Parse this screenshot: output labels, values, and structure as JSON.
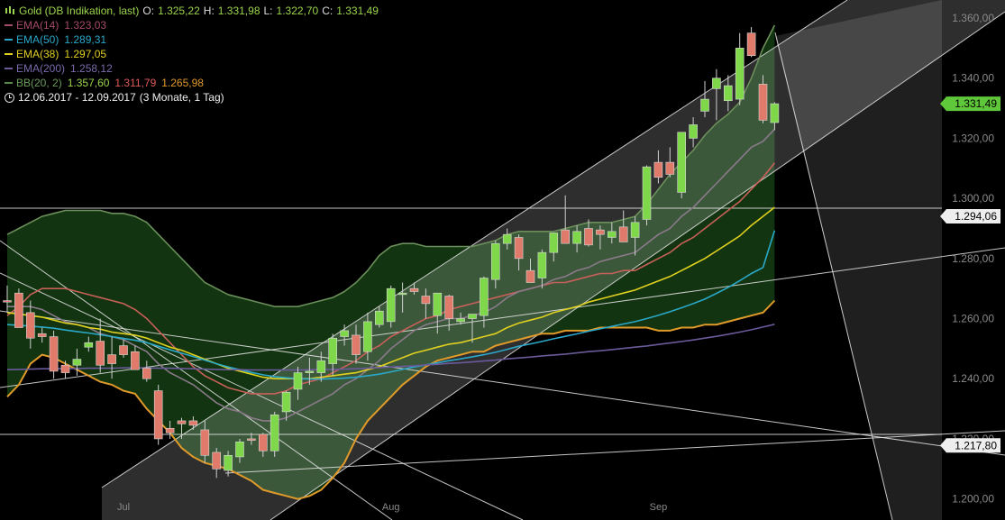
{
  "legend": {
    "symbol_label": "Gold (DB Indikation, last)",
    "ohlc": {
      "o_label": "O:",
      "o": "1.325,22",
      "h_label": "H:",
      "h": "1.331,98",
      "l_label": "L:",
      "l": "1.322,70",
      "c_label": "C:",
      "c": "1.331,49"
    },
    "indicators": [
      {
        "label": "EMA(14)",
        "value": "1.323,03",
        "color": "#a44a6a"
      },
      {
        "label": "EMA(50)",
        "value": "1.289,31",
        "color": "#2aa8c8"
      },
      {
        "label": "EMA(38)",
        "value": "1.297,05",
        "color": "#e0d020"
      },
      {
        "label": "EMA(200)",
        "value": "1.258,12",
        "color": "#6a5a9a"
      }
    ],
    "bb": {
      "label": "BB(20, 2)",
      "upper": "1.357,60",
      "mid": "1.311,79",
      "lower": "1.265,98",
      "color": "#5a8a4a",
      "upper_color": "#9bd44a",
      "mid_color": "#e05a5a",
      "lower_color": "#e09a2a"
    },
    "range": "12.06.2017 - 12.09.2017",
    "range_detail": "(3 Monate, 1 Tag)"
  },
  "chart_data": {
    "type": "candlestick",
    "title": "Gold (DB Indikation, last)",
    "period": "12.06.2017 - 12.09.2017",
    "ylim": [
      1193,
      1366
    ],
    "yticks": [
      1200,
      1220,
      1240,
      1260,
      1280,
      1300,
      1320,
      1340,
      1360
    ],
    "ytick_labels": [
      "1.200,00",
      "1.220,00",
      "1.240,00",
      "1.260,00",
      "1.280,00",
      "1.300,00",
      "1.320,00",
      "1.340,00",
      "1.360,00"
    ],
    "x_tick_labels": [
      {
        "label": "Jul",
        "at": 10
      },
      {
        "label": "Aug",
        "at": 33
      },
      {
        "label": "Sep",
        "at": 56
      }
    ],
    "price_tags": [
      {
        "label": "1.331,49",
        "value": 1331.49,
        "color": "#5fc83a",
        "text_color": "#000"
      },
      {
        "label": "1.294,06",
        "value": 1294.06,
        "color": "#eeeeee",
        "text_color": "#000"
      },
      {
        "label": "1.217,80",
        "value": 1217.8,
        "color": "#eeeeee",
        "text_color": "#000"
      }
    ],
    "horizontal_lines": [
      1294.06,
      1217.8
    ],
    "candles": [
      {
        "o": 1266.0,
        "h": 1271.0,
        "l": 1262.0,
        "c": 1265.5
      },
      {
        "o": 1268.5,
        "h": 1270.0,
        "l": 1260.0,
        "c": 1257.0
      },
      {
        "o": 1262.0,
        "h": 1266.0,
        "l": 1250.0,
        "c": 1253.5
      },
      {
        "o": 1255.0,
        "h": 1257.0,
        "l": 1252.0,
        "c": 1254.0
      },
      {
        "o": 1254.0,
        "h": 1256.0,
        "l": 1240.0,
        "c": 1242.5
      },
      {
        "o": 1244.5,
        "h": 1246.0,
        "l": 1240.0,
        "c": 1242.0
      },
      {
        "o": 1244.5,
        "h": 1250.0,
        "l": 1241.0,
        "c": 1246.5
      },
      {
        "o": 1250.5,
        "h": 1254.0,
        "l": 1249.0,
        "c": 1252.0
      },
      {
        "o": 1252.5,
        "h": 1260.0,
        "l": 1242.0,
        "c": 1244.5
      },
      {
        "o": 1248.0,
        "h": 1254.0,
        "l": 1240.0,
        "c": 1245.0
      },
      {
        "o": 1251.0,
        "h": 1253.0,
        "l": 1247.0,
        "c": 1248.0
      },
      {
        "o": 1249.0,
        "h": 1251.0,
        "l": 1244.0,
        "c": 1243.0
      },
      {
        "o": 1243.5,
        "h": 1246.0,
        "l": 1239.0,
        "c": 1240.0
      },
      {
        "o": 1236.0,
        "h": 1238.0,
        "l": 1218.0,
        "c": 1220.0
      },
      {
        "o": 1223.5,
        "h": 1226.0,
        "l": 1220.0,
        "c": 1222.0
      },
      {
        "o": 1226.0,
        "h": 1227.0,
        "l": 1220.0,
        "c": 1225.0
      },
      {
        "o": 1226.0,
        "h": 1227.5,
        "l": 1223.0,
        "c": 1224.5
      },
      {
        "o": 1223.0,
        "h": 1226.0,
        "l": 1212.0,
        "c": 1214.5
      },
      {
        "o": 1215.5,
        "h": 1217.0,
        "l": 1207.0,
        "c": 1210.0
      },
      {
        "o": 1209.5,
        "h": 1216.0,
        "l": 1207.5,
        "c": 1214.5
      },
      {
        "o": 1214.0,
        "h": 1220.0,
        "l": 1212.0,
        "c": 1219.0
      },
      {
        "o": 1220.0,
        "h": 1222.0,
        "l": 1218.0,
        "c": 1219.5
      },
      {
        "o": 1221.5,
        "h": 1222.0,
        "l": 1214.0,
        "c": 1216.0
      },
      {
        "o": 1216.0,
        "h": 1229.0,
        "l": 1214.0,
        "c": 1228.0
      },
      {
        "o": 1229.0,
        "h": 1236.0,
        "l": 1226.0,
        "c": 1235.5
      },
      {
        "o": 1236.5,
        "h": 1244.0,
        "l": 1233.0,
        "c": 1242.0
      },
      {
        "o": 1242.0,
        "h": 1247.0,
        "l": 1238.0,
        "c": 1242.5
      },
      {
        "o": 1242.0,
        "h": 1249.0,
        "l": 1239.0,
        "c": 1246.0
      },
      {
        "o": 1245.0,
        "h": 1255.0,
        "l": 1241.0,
        "c": 1253.5
      },
      {
        "o": 1254.0,
        "h": 1258.0,
        "l": 1251.0,
        "c": 1256.0
      },
      {
        "o": 1254.5,
        "h": 1258.0,
        "l": 1245.0,
        "c": 1248.0
      },
      {
        "o": 1249.0,
        "h": 1262.0,
        "l": 1246.0,
        "c": 1259.0
      },
      {
        "o": 1258.0,
        "h": 1264.0,
        "l": 1257.0,
        "c": 1262.5
      },
      {
        "o": 1259.0,
        "h": 1271.0,
        "l": 1257.0,
        "c": 1270.0
      },
      {
        "o": 1268.0,
        "h": 1272.0,
        "l": 1262.0,
        "c": 1268.5
      },
      {
        "o": 1270.0,
        "h": 1272.0,
        "l": 1268.0,
        "c": 1269.0
      },
      {
        "o": 1267.5,
        "h": 1270.0,
        "l": 1260.0,
        "c": 1265.0
      },
      {
        "o": 1261.0,
        "h": 1263.0,
        "l": 1255.0,
        "c": 1268.5
      },
      {
        "o": 1267.5,
        "h": 1268.0,
        "l": 1256.0,
        "c": 1260.0
      },
      {
        "o": 1259.0,
        "h": 1262.0,
        "l": 1258.0,
        "c": 1260.0
      },
      {
        "o": 1260.0,
        "h": 1261.0,
        "l": 1252.0,
        "c": 1261.5
      },
      {
        "o": 1261.0,
        "h": 1274.0,
        "l": 1257.0,
        "c": 1273.5
      },
      {
        "o": 1273.0,
        "h": 1286.0,
        "l": 1270.0,
        "c": 1285.0
      },
      {
        "o": 1285.0,
        "h": 1290.0,
        "l": 1283.0,
        "c": 1288.0
      },
      {
        "o": 1287.0,
        "h": 1288.0,
        "l": 1276.0,
        "c": 1280.0
      },
      {
        "o": 1276.0,
        "h": 1280.0,
        "l": 1273.0,
        "c": 1272.0
      },
      {
        "o": 1273.5,
        "h": 1283.0,
        "l": 1270.0,
        "c": 1282.0
      },
      {
        "o": 1282.0,
        "h": 1288.0,
        "l": 1279.0,
        "c": 1288.5
      },
      {
        "o": 1289.5,
        "h": 1301.0,
        "l": 1285.0,
        "c": 1285.0
      },
      {
        "o": 1285.0,
        "h": 1291.0,
        "l": 1282.0,
        "c": 1289.0
      },
      {
        "o": 1290.0,
        "h": 1293.0,
        "l": 1284.0,
        "c": 1284.5
      },
      {
        "o": 1289.5,
        "h": 1291.0,
        "l": 1283.0,
        "c": 1288.0
      },
      {
        "o": 1287.0,
        "h": 1292.0,
        "l": 1285.0,
        "c": 1289.0
      },
      {
        "o": 1290.5,
        "h": 1296.0,
        "l": 1286.0,
        "c": 1285.5
      },
      {
        "o": 1287.0,
        "h": 1294.0,
        "l": 1281.0,
        "c": 1292.0
      },
      {
        "o": 1293.0,
        "h": 1311.0,
        "l": 1291.0,
        "c": 1310.5
      },
      {
        "o": 1312.0,
        "h": 1316.0,
        "l": 1305.0,
        "c": 1307.0
      },
      {
        "o": 1312.0,
        "h": 1317.0,
        "l": 1307.0,
        "c": 1308.0
      },
      {
        "o": 1302.0,
        "h": 1322.0,
        "l": 1300.0,
        "c": 1322.0
      },
      {
        "o": 1320.0,
        "h": 1327.0,
        "l": 1317.0,
        "c": 1324.5
      },
      {
        "o": 1329.0,
        "h": 1339.0,
        "l": 1327.0,
        "c": 1333.0
      },
      {
        "o": 1336.5,
        "h": 1343.0,
        "l": 1326.0,
        "c": 1340.0
      },
      {
        "o": 1332.5,
        "h": 1341.0,
        "l": 1329.0,
        "c": 1337.5
      },
      {
        "o": 1333.0,
        "h": 1355.0,
        "l": 1331.0,
        "c": 1350.0
      },
      {
        "o": 1355.0,
        "h": 1357.0,
        "l": 1347.0,
        "c": 1347.5
      },
      {
        "o": 1338.0,
        "h": 1341.0,
        "l": 1325.0,
        "c": 1326.0
      },
      {
        "o": 1325.22,
        "h": 1331.98,
        "l": 1322.7,
        "c": 1331.49
      }
    ],
    "series": [
      {
        "name": "BB(20, 2) upper",
        "role": "bb_upper",
        "color": "#6b8f5a",
        "values": [
          1288.0,
          1290,
          1292,
          1294,
          1295,
          1296,
          1296,
          1296,
          1296,
          1295,
          1295,
          1294,
          1292,
          1288,
          1284,
          1280,
          1276,
          1272,
          1270,
          1268,
          1267,
          1266,
          1265,
          1264,
          1264,
          1264,
          1265,
          1266,
          1267,
          1269,
          1272,
          1276,
          1281,
          1284,
          1285,
          1285,
          1284,
          1284,
          1284,
          1284,
          1284,
          1285,
          1286,
          1288,
          1289,
          1289,
          1289,
          1289,
          1290,
          1291,
          1292,
          1292,
          1292,
          1293,
          1294,
          1298,
          1303,
          1308,
          1312,
          1316,
          1321,
          1325,
          1328,
          1332,
          1340,
          1350,
          1357.6
        ]
      },
      {
        "name": "BB(20, 2) lower",
        "role": "bb_lower",
        "color": "#e09a2a",
        "values": [
          1234.0,
          1238,
          1245,
          1248,
          1247,
          1245,
          1243,
          1241,
          1239,
          1238,
          1236,
          1235,
          1230,
          1226,
          1222,
          1217,
          1214,
          1212,
          1211,
          1210,
          1208,
          1206,
          1203,
          1202,
          1201,
          1200,
          1201,
          1203,
          1207,
          1212,
          1220,
          1226,
          1230,
          1234,
          1238,
          1241,
          1244,
          1246,
          1247,
          1248,
          1249,
          1249,
          1251,
          1252,
          1253,
          1254,
          1255,
          1255,
          1256,
          1256,
          1256,
          1257,
          1257,
          1257,
          1257,
          1257,
          1256,
          1256,
          1257,
          1257,
          1258,
          1258,
          1259,
          1260,
          1261,
          1262,
          1265.98
        ]
      },
      {
        "name": "BB(20, 2) mid",
        "role": "bb_mid",
        "color": "#c8605a",
        "values": [
          1261.0,
          1264,
          1268,
          1270,
          1270,
          1270,
          1269,
          1268,
          1267,
          1266,
          1265,
          1263,
          1260,
          1256,
          1252,
          1248,
          1244,
          1241,
          1239,
          1237,
          1236,
          1235,
          1235,
          1235,
          1236,
          1238,
          1239,
          1240,
          1242,
          1244,
          1246,
          1249,
          1251,
          1254,
          1256,
          1258,
          1260,
          1261,
          1263,
          1264,
          1265,
          1266,
          1267,
          1268,
          1269,
          1270,
          1271,
          1272,
          1272,
          1273,
          1274,
          1275,
          1275,
          1276,
          1276,
          1278,
          1280,
          1282,
          1285,
          1287,
          1290,
          1293,
          1296,
          1299,
          1303,
          1307,
          1311.79
        ]
      },
      {
        "name": "EMA(14)",
        "color": "#8a7a8a",
        "values": [
          1264.0,
          1264,
          1264,
          1263,
          1261,
          1259,
          1258,
          1257,
          1255,
          1254,
          1253,
          1251,
          1249,
          1245,
          1242,
          1240,
          1238,
          1235,
          1232,
          1230,
          1229,
          1227,
          1226,
          1226,
          1227,
          1229,
          1231,
          1233,
          1235,
          1238,
          1240,
          1243,
          1246,
          1250,
          1253,
          1256,
          1258,
          1259,
          1260,
          1260,
          1261,
          1262,
          1264,
          1267,
          1269,
          1270,
          1271,
          1273,
          1274,
          1276,
          1277,
          1279,
          1280,
          1281,
          1282,
          1285,
          1288,
          1290,
          1294,
          1297,
          1301,
          1305,
          1309,
          1313,
          1317,
          1319,
          1323.03
        ]
      },
      {
        "name": "EMA(38)",
        "color": "#e0d020",
        "values": [
          1262.0,
          1261.5,
          1261,
          1260.5,
          1259.5,
          1258.5,
          1258,
          1257,
          1256.5,
          1255.5,
          1255,
          1254.5,
          1253.5,
          1252,
          1250.5,
          1249.5,
          1248,
          1246.5,
          1245,
          1243.5,
          1242.5,
          1241.5,
          1240.5,
          1240,
          1240,
          1240,
          1240,
          1240.5,
          1241,
          1241.5,
          1242,
          1243,
          1244,
          1245.5,
          1247,
          1248.5,
          1249.5,
          1250.5,
          1251.5,
          1252,
          1253,
          1254,
          1255,
          1257,
          1258.5,
          1259.5,
          1260.5,
          1262,
          1263,
          1264,
          1265.5,
          1266.5,
          1267.5,
          1268.5,
          1269.5,
          1271,
          1272.5,
          1274,
          1276,
          1278,
          1280,
          1282.5,
          1285,
          1287.5,
          1291,
          1294,
          1297.05
        ]
      },
      {
        "name": "EMA(50)",
        "color": "#2aa8c8",
        "values": [
          1258.0,
          1257.8,
          1257.5,
          1257.2,
          1256.8,
          1256.2,
          1255.7,
          1255.2,
          1254.6,
          1254,
          1253.4,
          1252.8,
          1252,
          1250.8,
          1249.6,
          1248.5,
          1247.4,
          1246.2,
          1245,
          1243.9,
          1243,
          1242.1,
          1241.3,
          1240.7,
          1240.3,
          1240,
          1239.9,
          1239.9,
          1240,
          1240.2,
          1240.5,
          1241,
          1241.5,
          1242.3,
          1243.1,
          1243.9,
          1244.6,
          1245.3,
          1246,
          1246.6,
          1247.3,
          1248,
          1248.8,
          1249.8,
          1250.8,
          1251.6,
          1252.4,
          1253.3,
          1254.1,
          1254.9,
          1255.8,
          1256.6,
          1257.4,
          1258.2,
          1259,
          1260,
          1261.1,
          1262.3,
          1263.6,
          1265,
          1266.5,
          1268.4,
          1270.4,
          1272.6,
          1275,
          1277,
          1289.31
        ]
      },
      {
        "name": "EMA(200)",
        "color": "#6a5a9a",
        "values": [
          1243.0,
          1243.1,
          1243.2,
          1243.3,
          1243.3,
          1243.4,
          1243.4,
          1243.5,
          1243.5,
          1243.5,
          1243.6,
          1243.6,
          1243.6,
          1243.5,
          1243.5,
          1243.4,
          1243.3,
          1243.2,
          1243.1,
          1243,
          1243,
          1242.9,
          1242.9,
          1242.9,
          1242.9,
          1242.9,
          1243,
          1243,
          1243.1,
          1243.2,
          1243.3,
          1243.5,
          1243.7,
          1243.9,
          1244.1,
          1244.3,
          1244.6,
          1244.8,
          1245.1,
          1245.3,
          1245.6,
          1245.9,
          1246.2,
          1246.6,
          1246.9,
          1247.2,
          1247.6,
          1247.9,
          1248.2,
          1248.6,
          1249,
          1249.3,
          1249.7,
          1250.1,
          1250.5,
          1250.9,
          1251.4,
          1251.9,
          1252.4,
          1252.9,
          1253.5,
          1254.1,
          1254.8,
          1255.5,
          1256.3,
          1257.2,
          1258.12
        ]
      }
    ]
  }
}
